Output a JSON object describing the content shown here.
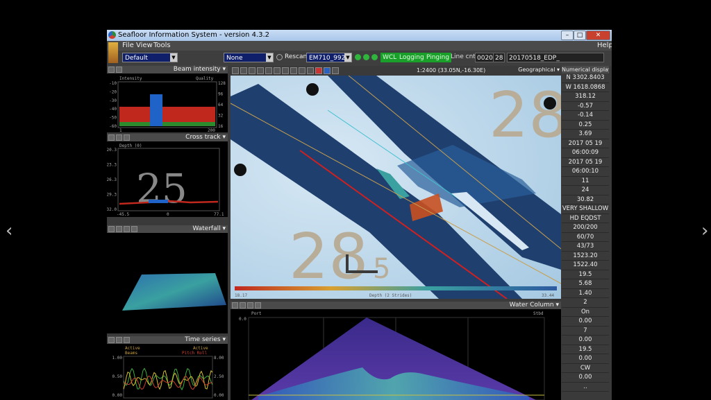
{
  "app": {
    "title": "Seafloor Information System - version 4.3.2",
    "help": "Help"
  },
  "menu": {
    "file": "File",
    "view": "View",
    "tools": "Tools"
  },
  "toolbar": {
    "profile": "Default",
    "none_select": "None",
    "rescan": "Rescan",
    "sonar": "EM710_992",
    "wcl": "WCL",
    "logging": "Logging",
    "pinging": "Pinging",
    "line_cnt_label": "Line cnt.",
    "line_cnt": "0020",
    "line_no": "28",
    "file": "20170518_EDP_"
  },
  "colors": {
    "active_green": "#1aa02a",
    "select_blue": "#0f1f6a",
    "swath_blue": "#1f3f6e",
    "chart_water": "#b8d6ea"
  },
  "beam": {
    "title": "Beam intensity",
    "left_label": "Intensity",
    "right_label": "Quality",
    "left_ticks": [
      "-10",
      "-20",
      "-30",
      "-40",
      "-50",
      "-60"
    ],
    "right_ticks": [
      "128",
      "96",
      "64",
      "32",
      "16"
    ],
    "x_ticks": [
      "1",
      "200"
    ]
  },
  "cross": {
    "title": "Cross track",
    "label": "Depth (0)",
    "big_number": "25",
    "y_ticks": [
      "20.3",
      "23.3",
      "26.3",
      "29.3",
      "32.0"
    ],
    "x_ticks": [
      "-45.5",
      "0",
      "77.1"
    ]
  },
  "waterfall": {
    "title": "Waterfall"
  },
  "timeseries": {
    "title": "Time series",
    "active_left": "Active",
    "beams": "Beams",
    "active_right": "Active",
    "pitch_roll": "Pitch Roll",
    "left_ticks": [
      "1.00",
      "0.50",
      "0.00"
    ],
    "right_ticks": [
      "8.00",
      "2.50",
      "0.00"
    ]
  },
  "geo": {
    "scale_text": "1:2400 (33.05N,-16.30E)",
    "title": "Geographical",
    "depth_scale_label": "Depth (2 Strides)",
    "depth_min": "18.17",
    "depth_max": "33.44"
  },
  "numerical": {
    "title": "Numerical display",
    "values": [
      "N 3302.8403",
      "W 1618.0868",
      "318.12",
      "-0.57",
      "-0.14",
      "0.25",
      "3.69",
      "2017 05 19",
      "06:00:09",
      "2017 05 19",
      "06:00:10",
      "11",
      "24",
      "30.82",
      "VERY SHALLOW",
      "HD EQDST",
      "200/200",
      "60/70",
      "43/73",
      "1523.20",
      "1522.40",
      "19.5",
      "5.68",
      "1.40",
      "2",
      "On",
      "0.00",
      "7",
      "0.00",
      "19.5",
      "0.00",
      "CW",
      "0.00",
      ".."
    ]
  },
  "watercolumn": {
    "title": "Water Column",
    "port": "Port",
    "stbd": "Stbd",
    "y_tick": "0.0"
  }
}
